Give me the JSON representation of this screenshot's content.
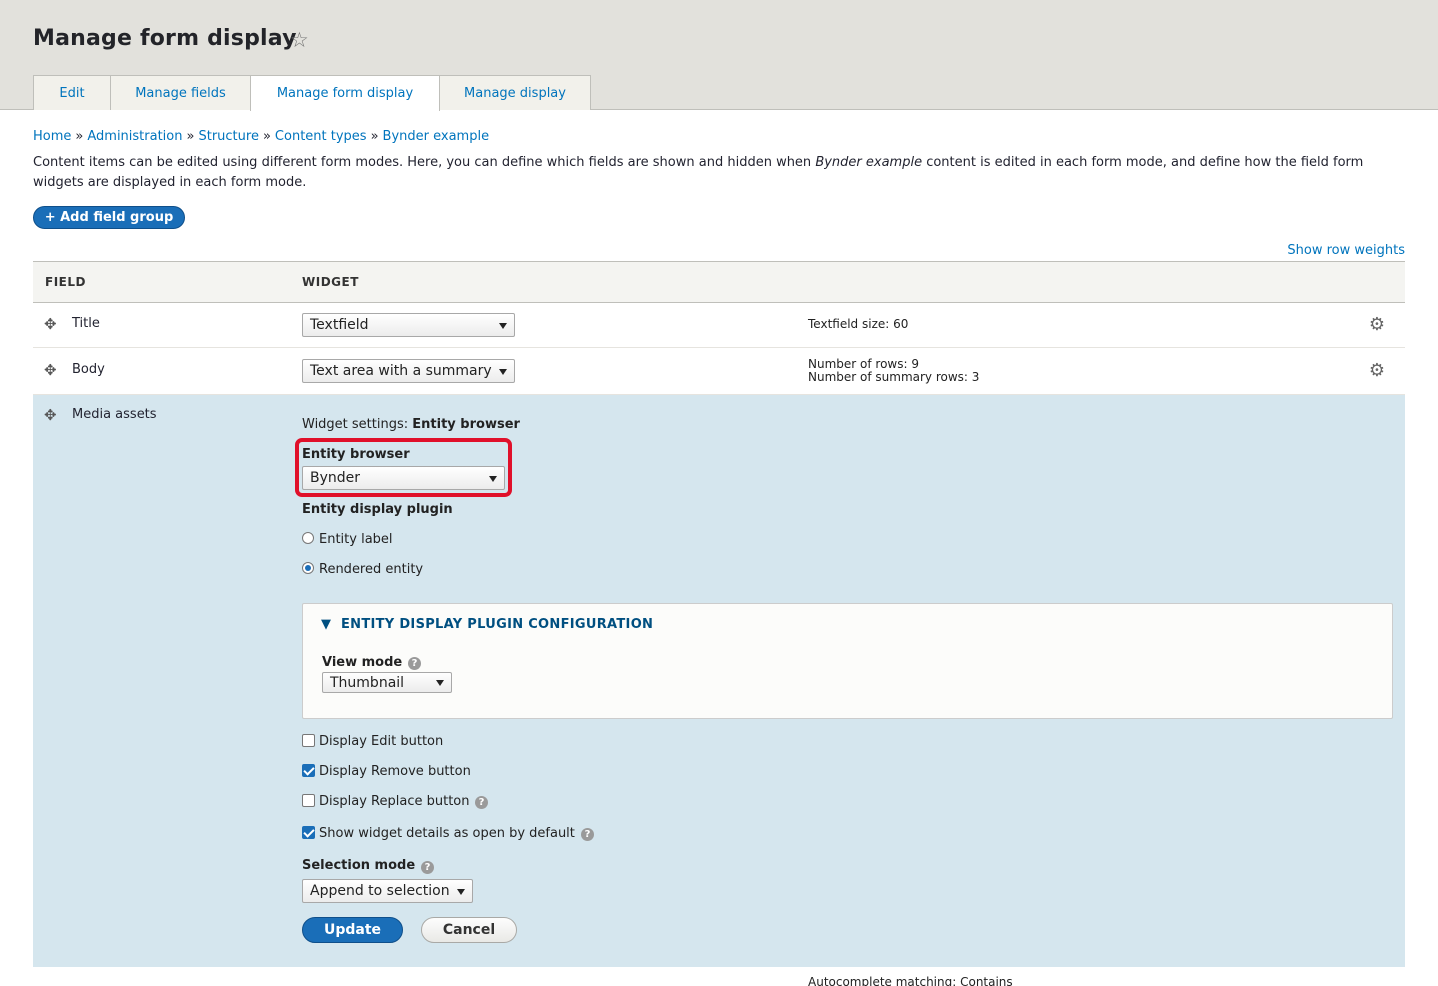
{
  "header": {
    "title": "Manage form display"
  },
  "tabs": [
    {
      "label": "Edit",
      "active": false
    },
    {
      "label": "Manage fields",
      "active": false
    },
    {
      "label": "Manage form display",
      "active": true
    },
    {
      "label": "Manage display",
      "active": false
    }
  ],
  "breadcrumb": [
    "Home",
    "Administration",
    "Structure",
    "Content types",
    "Bynder example"
  ],
  "breadcrumb_separator": "»",
  "description": {
    "before": "Content items can be edited using different form modes. Here, you can define which fields are shown and hidden when ",
    "em": "Bynder example",
    "after": " content is edited in each form mode, and define how the field form widgets are displayed in each form mode."
  },
  "add_field_group": "+ Add field group",
  "show_row_weights": "Show row weights",
  "table": {
    "headers": {
      "field": "FIELD",
      "widget": "WIDGET"
    },
    "rows": [
      {
        "field": "Title",
        "widget": "Textfield",
        "summary": [
          "Textfield size: 60"
        ]
      },
      {
        "field": "Body",
        "widget": "Text area with a summary",
        "summary": [
          "Number of rows: 9",
          "Number of summary rows: 3"
        ]
      }
    ]
  },
  "media": {
    "field": "Media assets",
    "widget_settings_label": "Widget settings:",
    "widget_settings_value": "Entity browser",
    "entity_browser_label": "Entity browser",
    "entity_browser_value": "Bynder",
    "display_plugin_label": "Entity display plugin",
    "radio_entity_label": "Entity label",
    "radio_rendered_entity": "Rendered entity",
    "radio_selected": "Rendered entity",
    "details_title": "ENTITY DISPLAY PLUGIN CONFIGURATION",
    "view_mode_label": "View mode",
    "view_mode_value": "Thumbnail",
    "checkboxes": [
      {
        "label": "Display Edit button",
        "checked": false,
        "help": false
      },
      {
        "label": "Display Remove button",
        "checked": true,
        "help": false
      },
      {
        "label": "Display Replace button",
        "checked": false,
        "help": true
      },
      {
        "label": "Show widget details as open by default",
        "checked": true,
        "help": true
      }
    ],
    "selection_mode_label": "Selection mode",
    "selection_mode_value": "Append to selection",
    "update": "Update",
    "cancel": "Cancel"
  },
  "next_row_summary": "Autocomplete matching: Contains",
  "icons": {
    "star": "star-outline-icon",
    "drag": "move-arrows-icon",
    "gear": "gear-icon",
    "help": "question-icon",
    "caret": "triangle-down-icon"
  },
  "colors": {
    "accent": "#1a6eb8",
    "link": "#0074bd",
    "highlight": "#e0102a",
    "media_row_bg": "#d5e6ee",
    "header_bg": "#e2e1dc"
  }
}
